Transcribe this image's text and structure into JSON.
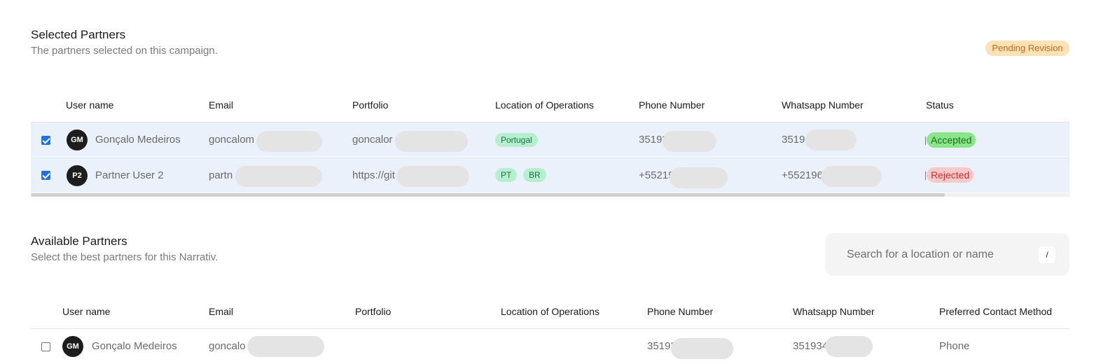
{
  "selected": {
    "title": "Selected Partners",
    "subtitle": "The partners selected on this campaign.",
    "badge": "Pending Revision",
    "columns": [
      "User name",
      "Email",
      "Portfolio",
      "Location of Operations",
      "Phone Number",
      "Whatsapp Number",
      "Status"
    ],
    "rows": [
      {
        "checked": true,
        "initials": "GM",
        "name": "Gonçalo Medeiros",
        "email": "goncalom",
        "portfolio": "goncalor",
        "locations": [
          "Portugal"
        ],
        "phone": "35193",
        "whatsapp": "3519",
        "status": "Accepted"
      },
      {
        "checked": true,
        "initials": "P2",
        "name": "Partner User 2",
        "email": "partn",
        "portfolio": "https://git",
        "locations": [
          "PT",
          "BR"
        ],
        "phone": "+55219",
        "whatsapp": "+552196",
        "status": "Rejected"
      }
    ]
  },
  "available": {
    "title": "Available Partners",
    "subtitle": "Select the best partners for this Narrativ.",
    "search_placeholder": "Search for a location or name",
    "search_shortcut": "/",
    "columns": [
      "User name",
      "Email",
      "Portfolio",
      "Location of Operations",
      "Phone Number",
      "Whatsapp Number",
      "Preferred Contact Method"
    ],
    "rows": [
      {
        "checked": false,
        "initials": "GM",
        "name": "Gonçalo Medeiros",
        "email": "goncalo",
        "phone": "35193",
        "whatsapp": "351934",
        "contact_method": "Phone"
      }
    ]
  },
  "colors": {
    "accepted_bg": "#8be68b",
    "rejected_bg": "#f9c9c9",
    "pending_bg": "#fde2b8",
    "selected_row_bg": "#ebf1fb"
  }
}
